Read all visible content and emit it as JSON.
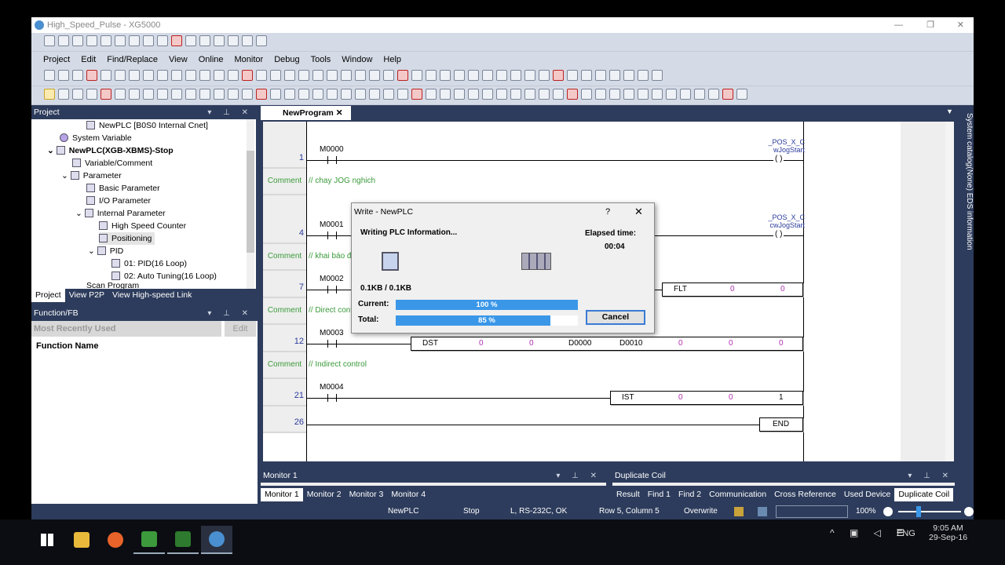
{
  "window": {
    "title": "High_Speed_Pulse - XG5000"
  },
  "menu": [
    "Project",
    "Edit",
    "Find/Replace",
    "View",
    "Online",
    "Monitor",
    "Debug",
    "Tools",
    "Window",
    "Help"
  ],
  "project_panel": {
    "title": "Project",
    "tree": [
      "NewPLC [B0S0 Internal Cnet]",
      "System Variable",
      "NewPLC(XGB-XBMS)-Stop",
      "Variable/Comment",
      "Parameter",
      "Basic Parameter",
      "I/O Parameter",
      "Internal Parameter",
      "High Speed Counter",
      "Positioning",
      "PID",
      "01: PID(16 Loop)",
      "02: Auto Tuning(16 Loop)",
      "Scan Program"
    ],
    "selected": "Positioning",
    "tabs": [
      "Project",
      "View P2P",
      "View High-speed Link"
    ]
  },
  "function_panel": {
    "title": "Function/FB",
    "dropdown": "Most Recently Used",
    "edit": "Edit",
    "column": "Function Name"
  },
  "editor": {
    "tab": "NewProgram",
    "comment_label": "Comment",
    "rungs": [
      {
        "num": "1",
        "contact": "M0000",
        "coil": [
          "_POS_X_C",
          "wJogStart"
        ]
      },
      {
        "comment": "// chay JOG nghich"
      },
      {
        "num": "4",
        "contact": "M0001",
        "coil": [
          "_POS_X_C",
          "cwJogStart"
        ]
      },
      {
        "comment": "// khai báo đi"
      },
      {
        "num": "7",
        "contact": "M0002",
        "box": [
          "FLT",
          "0",
          "0"
        ]
      },
      {
        "comment": "// Direct cont"
      },
      {
        "num": "12",
        "contact": "M0003",
        "box": [
          "DST",
          "0",
          "0",
          "D0000",
          "D0010",
          "0",
          "0",
          "0"
        ]
      },
      {
        "comment": "// Indirect control"
      },
      {
        "num": "21",
        "contact": "M0004",
        "box": [
          "IST",
          "0",
          "0",
          "1"
        ]
      },
      {
        "num": "26",
        "box": [
          "END"
        ]
      }
    ]
  },
  "dialog": {
    "title": "Write - NewPLC",
    "help": "?",
    "status": "Writing PLC Information...",
    "elapsed_label": "Elapsed time:",
    "elapsed": "00:04",
    "size": "0.1KB / 0.1KB",
    "current_label": "Current:",
    "current_pct": 100,
    "current_text": "100 %",
    "total_label": "Total:",
    "total_pct": 85,
    "total_text": "85 %",
    "cancel": "Cancel"
  },
  "bottom": {
    "monitor_title": "Monitor 1",
    "monitor_tabs": [
      "Monitor 1",
      "Monitor 2",
      "Monitor 3",
      "Monitor 4"
    ],
    "dup_title": "Duplicate Coil",
    "dup_tabs": [
      "Result",
      "Find 1",
      "Find 2",
      "Communication",
      "Cross Reference",
      "Used Device",
      "Duplicate Coil"
    ]
  },
  "side_strip": "System catalog(None)  EDS information",
  "status": {
    "plc": "NewPLC",
    "mode": "Stop",
    "conn": "L, RS-232C, OK",
    "pos": "Row 5, Column 5",
    "ins": "Overwrite",
    "zoom": "100%"
  },
  "taskbar": {
    "time": "9:05 AM",
    "date": "29-Sep-16",
    "lang": "ENG"
  },
  "colors": {
    "frame": "#2d3c5c",
    "progress": "#3a97e8",
    "comment": "#3a9a3a",
    "operand": "#b030b0"
  }
}
